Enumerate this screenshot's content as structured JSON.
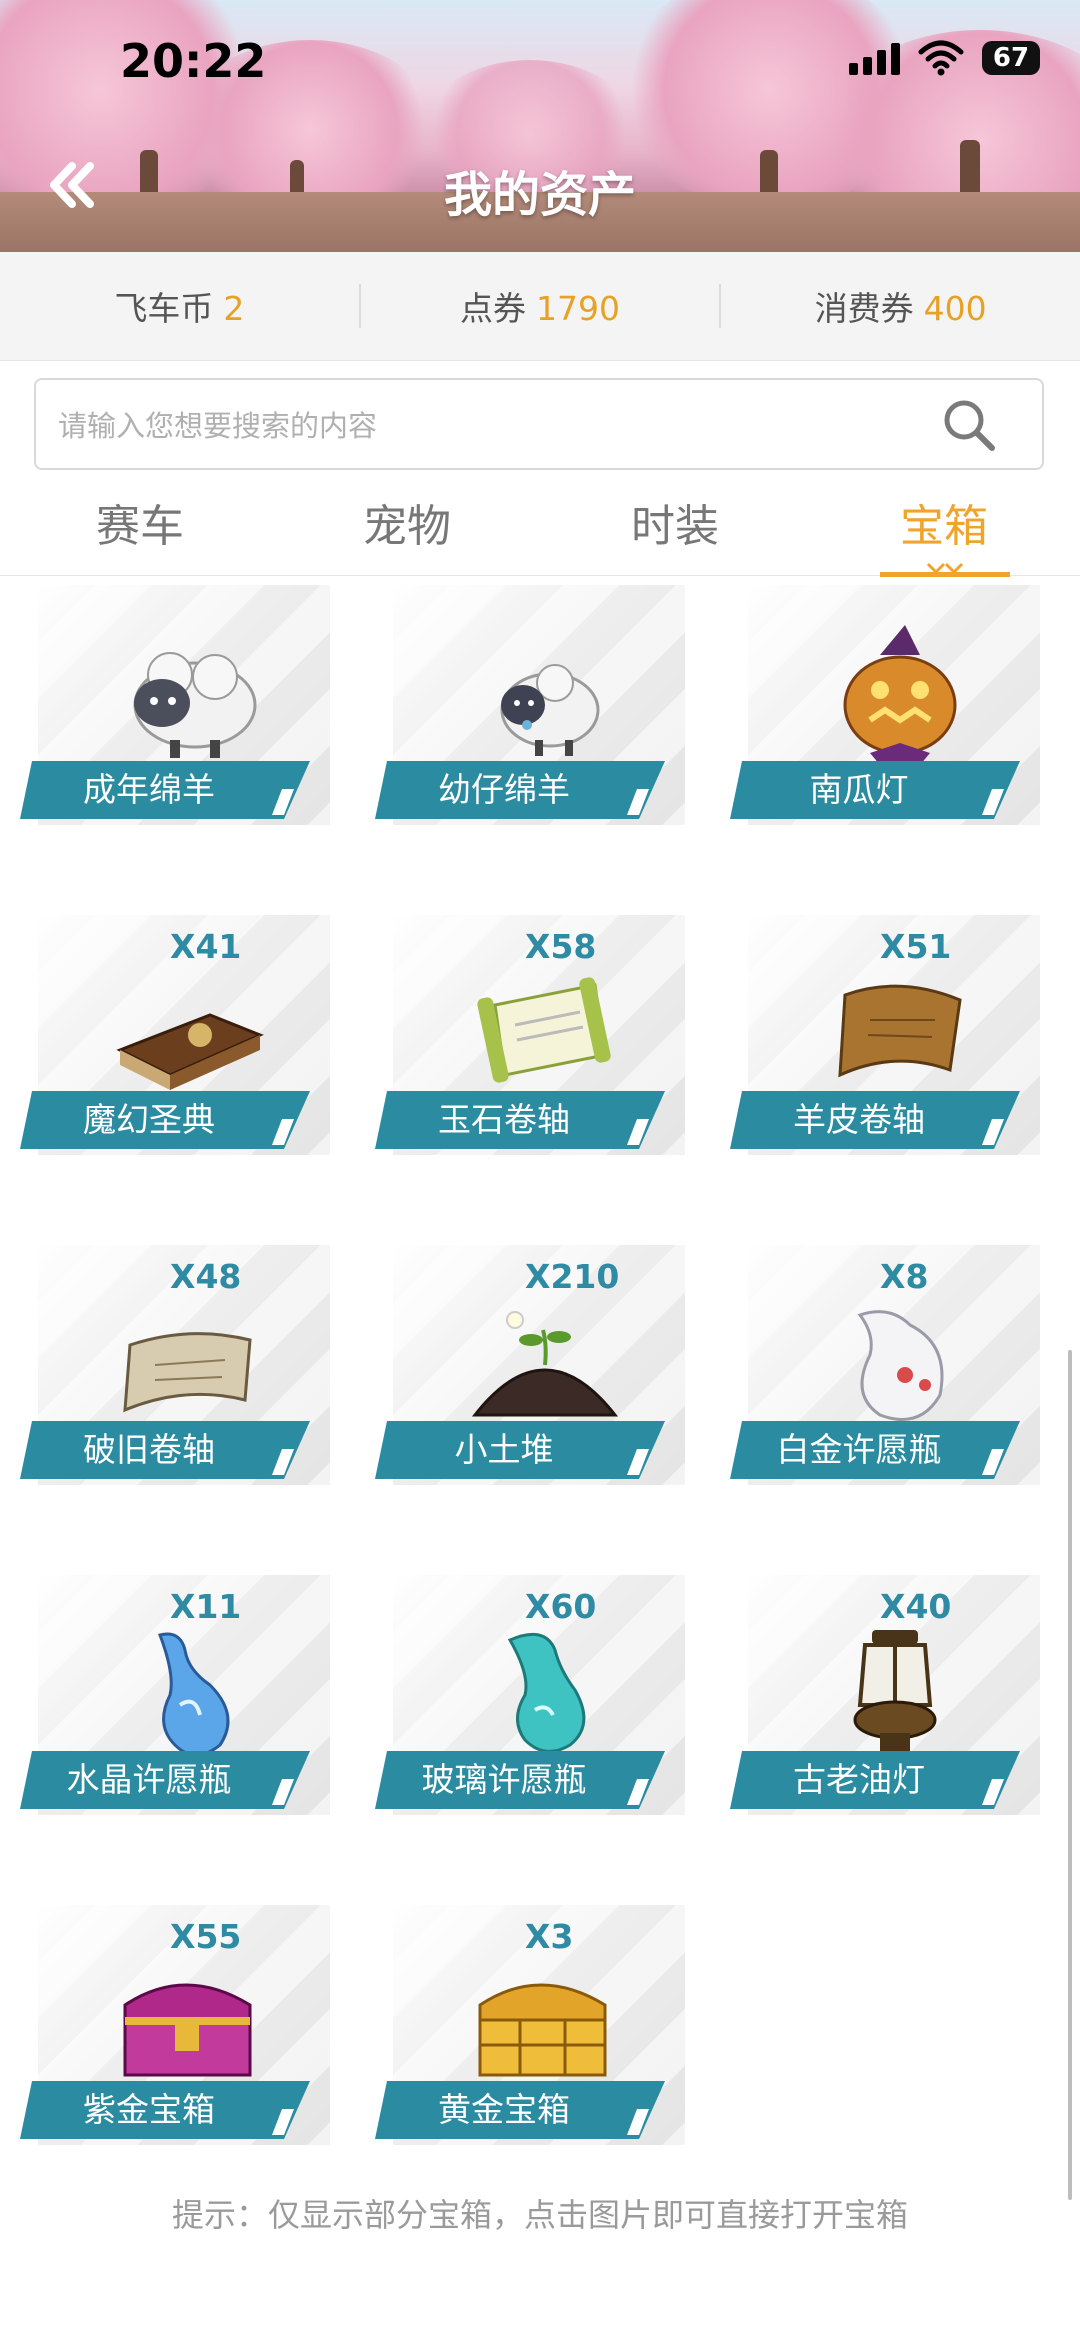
{
  "status": {
    "time": "20:22",
    "battery": "67"
  },
  "header": {
    "title": "我的资产"
  },
  "balance": [
    {
      "label": "飞车币",
      "value": "2"
    },
    {
      "label": "点券",
      "value": "1790"
    },
    {
      "label": "消费券",
      "value": "400"
    }
  ],
  "search": {
    "placeholder": "请输入您想要搜索的内容",
    "value": ""
  },
  "tabs": [
    {
      "label": "赛车",
      "active": false
    },
    {
      "label": "宠物",
      "active": false
    },
    {
      "label": "时装",
      "active": false
    },
    {
      "label": "宝箱",
      "active": true
    }
  ],
  "items": [
    {
      "name": "成年绵羊",
      "count": "",
      "icon": "adult-sheep-icon"
    },
    {
      "name": "幼仔绵羊",
      "count": "",
      "icon": "baby-sheep-icon"
    },
    {
      "name": "南瓜灯",
      "count": "",
      "icon": "pumpkin-lantern-icon"
    },
    {
      "name": "魔幻圣典",
      "count": "X41",
      "icon": "magic-book-icon"
    },
    {
      "name": "玉石卷轴",
      "count": "X58",
      "icon": "jade-scroll-icon"
    },
    {
      "name": "羊皮卷轴",
      "count": "X51",
      "icon": "parchment-scroll-icon"
    },
    {
      "name": "破旧卷轴",
      "count": "X48",
      "icon": "old-scroll-icon"
    },
    {
      "name": "小土堆",
      "count": "X210",
      "icon": "dirt-mound-icon"
    },
    {
      "name": "白金许愿瓶",
      "count": "X8",
      "icon": "platinum-wish-bottle-icon"
    },
    {
      "name": "水晶许愿瓶",
      "count": "X11",
      "icon": "crystal-wish-bottle-icon"
    },
    {
      "name": "玻璃许愿瓶",
      "count": "X60",
      "icon": "glass-wish-bottle-icon"
    },
    {
      "name": "古老油灯",
      "count": "X40",
      "icon": "oil-lamp-icon"
    },
    {
      "name": "紫金宝箱",
      "count": "X55",
      "icon": "purple-gold-chest-icon"
    },
    {
      "name": "黄金宝箱",
      "count": "X3",
      "icon": "golden-chest-icon"
    }
  ],
  "hint": "提示：仅显示部分宝箱，点击图片即可直接打开宝箱",
  "colors": {
    "accent": "#f0a42c",
    "label_bg": "#2a8ba1",
    "count": "#2f8aa3"
  }
}
